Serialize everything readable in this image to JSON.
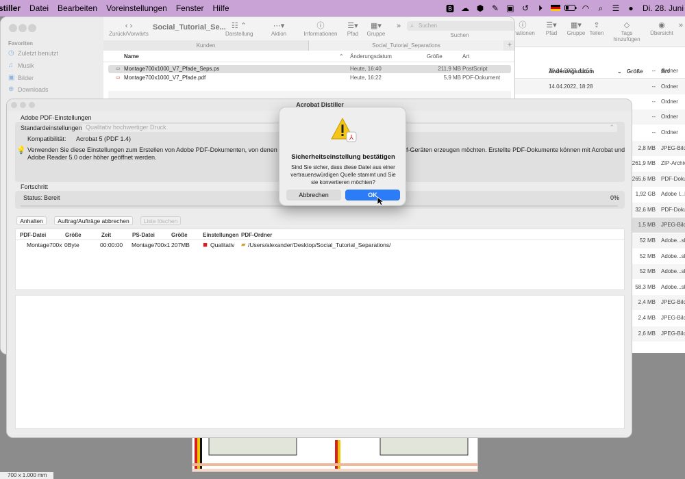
{
  "menubar": {
    "app": "stiller",
    "items": [
      "Datei",
      "Bearbeiten",
      "Voreinstellungen",
      "Fenster",
      "Hilfe"
    ],
    "clock": "Di. 28. Juni",
    "flag_color": "#000000"
  },
  "finder_left": {
    "title": "Social_Tutorial_Se...",
    "toolbar": {
      "nav_label": "Zurück/Vorwärts",
      "view_label": "Darstellung",
      "action_label": "Aktion",
      "info_label": "Informationen",
      "path_label": "Pfad",
      "group_label": "Gruppe",
      "search_label": "Suchen",
      "search_placeholder": "Suchen"
    },
    "tabs": [
      "Kunden",
      "Social_Tutorial_Separations"
    ],
    "sidebar": {
      "header": "Favoriten",
      "items": [
        "Zuletzt benutzt",
        "Musik",
        "Bilder",
        "Downloads"
      ]
    },
    "columns": {
      "name": "Name",
      "date": "Änderungsdatum",
      "size": "Größe",
      "kind": "Art"
    },
    "files": [
      {
        "name": "Montage700x1000_V7_Pfade_Seps.ps",
        "date": "Heute, 16:40",
        "size": "211,9 MB",
        "kind": "PostScript"
      },
      {
        "name": "Montage700x1000_V7_Pfade.pdf",
        "date": "Heute, 16:22",
        "size": "5,9 MB",
        "kind": "PDF-Dokument"
      }
    ]
  },
  "finder_right": {
    "toolbar": {
      "info": "rmationen",
      "path": "Pfad",
      "group": "Gruppe",
      "share": "Teilen",
      "tags": "Tags hinzufügen",
      "preview": "Übersicht"
    },
    "columns": {
      "date": "Änderungsdatum",
      "size": "Größe",
      "kind": "Art"
    },
    "rows": [
      {
        "date": "20.04.2022, 11:56",
        "size": "--",
        "kind": "Ordner"
      },
      {
        "date": "14.04.2022, 18:28",
        "size": "--",
        "kind": "Ordner"
      },
      {
        "date": "",
        "size": "--",
        "kind": "Ordner"
      },
      {
        "date": "",
        "size": "--",
        "kind": "Ordner"
      },
      {
        "date": "",
        "size": "--",
        "kind": "Ordner"
      },
      {
        "date": "",
        "size": "2,8 MB",
        "kind": "JPEG-Bild"
      },
      {
        "date": "",
        "size": "261,9 MB",
        "kind": "ZIP-Archiv"
      },
      {
        "date": "",
        "size": "265,6 MB",
        "kind": "PDF-Doku"
      },
      {
        "date": "",
        "size": "1,92 GB",
        "kind": "Adobe I...k"
      },
      {
        "date": "",
        "size": "32,6 MB",
        "kind": "PDF-Doku"
      },
      {
        "date": "",
        "size": "1,5 MB",
        "kind": "JPEG-Bild"
      },
      {
        "date": "",
        "size": "52 MB",
        "kind": "Adobe...sh"
      },
      {
        "date": "",
        "size": "52 MB",
        "kind": "Adobe...sh"
      },
      {
        "date": "",
        "size": "52 MB",
        "kind": "Adobe...sh"
      },
      {
        "date": "",
        "size": "58,3 MB",
        "kind": "Adobe...sh"
      },
      {
        "date": "",
        "size": "2,4 MB",
        "kind": "JPEG-Bild"
      },
      {
        "date": "",
        "size": "2,4 MB",
        "kind": "JPEG-Bild"
      },
      {
        "date": "",
        "size": "2,6 MB",
        "kind": "JPEG-Bild"
      }
    ]
  },
  "distiller": {
    "title": "Acrobat Distiller",
    "settings_header": "Adobe PDF-Einstellungen",
    "default_label": "Standardeinstellungen:",
    "default_value": "Qualitativ hochwertiger Druck",
    "compat_label": "Kompatibilität:",
    "compat_value": "Acrobat 5 (PDF 1.4)",
    "description_a": "Verwenden Sie diese Einstellungen zum Erstellen von Adobe PDF-Dokumenten, von denen Sie ho",
    "description_b": "pf-Geräten erzeugen möchten. Erstellte PDF-Dokumente können mit Acrobat und",
    "description_c": "Adobe Reader 5.0 oder höher geöffnet werden.",
    "progress_header": "Fortschritt",
    "status_label": "Status:",
    "status_value": "Bereit",
    "progress_text": "0%",
    "progress": 0,
    "buttons": {
      "pause": "Anhalten",
      "cancel_jobs": "Auftrag/Aufträge abbrechen",
      "clear_list": "Liste löschen"
    },
    "job_columns": [
      "PDF-Datei",
      "Größe",
      "Zeit",
      "PS-Datei",
      "Größe",
      "Einstellungen",
      "PDF-Ordner"
    ],
    "jobs": [
      {
        "pdf": "Montage700x",
        "size": "0Byte",
        "time": "00:00:00",
        "ps": "Montage700x1",
        "ps_size": "207MB",
        "settings": "Qualitativ",
        "folder": "/Users/alexander/Desktop/Social_Tutorial_Separations/"
      }
    ]
  },
  "dialog": {
    "title": "Sicherheitseinstellung bestätigen",
    "message": "Sind Sie sicher, dass diese Datei aus einer vertrauenswürdigen Quelle stammt und Sie sie konvertieren möchten?",
    "cancel": "Abbrechen",
    "ok": "OK"
  },
  "bottom_label": "700 x 1.000 mm"
}
